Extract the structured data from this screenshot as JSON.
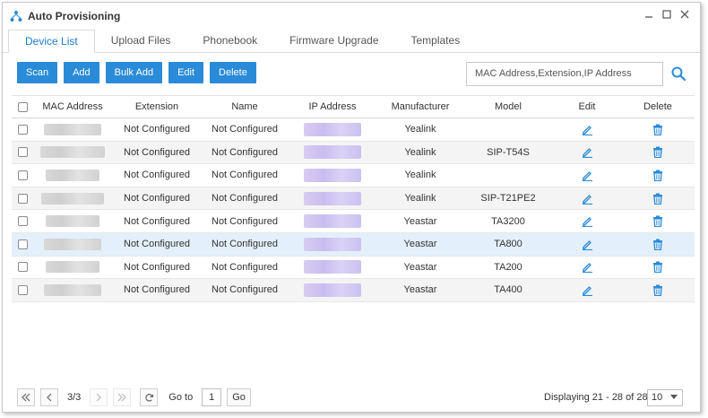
{
  "window": {
    "title": "Auto Provisioning"
  },
  "tabs": [
    "Device List",
    "Upload Files",
    "Phonebook",
    "Firmware Upgrade",
    "Templates"
  ],
  "toolbar": {
    "scan": "Scan",
    "add": "Add",
    "bulk_add": "Bulk Add",
    "edit": "Edit",
    "delete": "Delete"
  },
  "search": {
    "placeholder": "MAC Address,Extension,IP Address"
  },
  "table": {
    "headers": [
      "MAC Address",
      "Extension",
      "Name",
      "IP Address",
      "Manufacturer",
      "Model",
      "Edit",
      "Delete"
    ],
    "rows": [
      {
        "extension": "Not Configured",
        "name": "Not Configured",
        "manufacturer": "Yealink",
        "model": ""
      },
      {
        "extension": "Not Configured",
        "name": "Not Configured",
        "manufacturer": "Yealink",
        "model": "SIP-T54S"
      },
      {
        "extension": "Not Configured",
        "name": "Not Configured",
        "manufacturer": "Yealink",
        "model": ""
      },
      {
        "extension": "Not Configured",
        "name": "Not Configured",
        "manufacturer": "Yealink",
        "model": "SIP-T21PE2"
      },
      {
        "extension": "Not Configured",
        "name": "Not Configured",
        "manufacturer": "Yeastar",
        "model": "TA3200"
      },
      {
        "extension": "Not Configured",
        "name": "Not Configured",
        "manufacturer": "Yeastar",
        "model": "TA800"
      },
      {
        "extension": "Not Configured",
        "name": "Not Configured",
        "manufacturer": "Yeastar",
        "model": "TA200"
      },
      {
        "extension": "Not Configured",
        "name": "Not Configured",
        "manufacturer": "Yeastar",
        "model": "TA400"
      }
    ]
  },
  "pager": {
    "page_info": "3/3",
    "goto_label": "Go to",
    "goto_value": "1",
    "go_button": "Go",
    "displaying": "Displaying 21 - 28 of 28",
    "page_size": "10"
  },
  "colors": {
    "accent": "#2a8bd8",
    "selected_row": "#e3f0fb",
    "tab_active": "#1a7bd0"
  }
}
